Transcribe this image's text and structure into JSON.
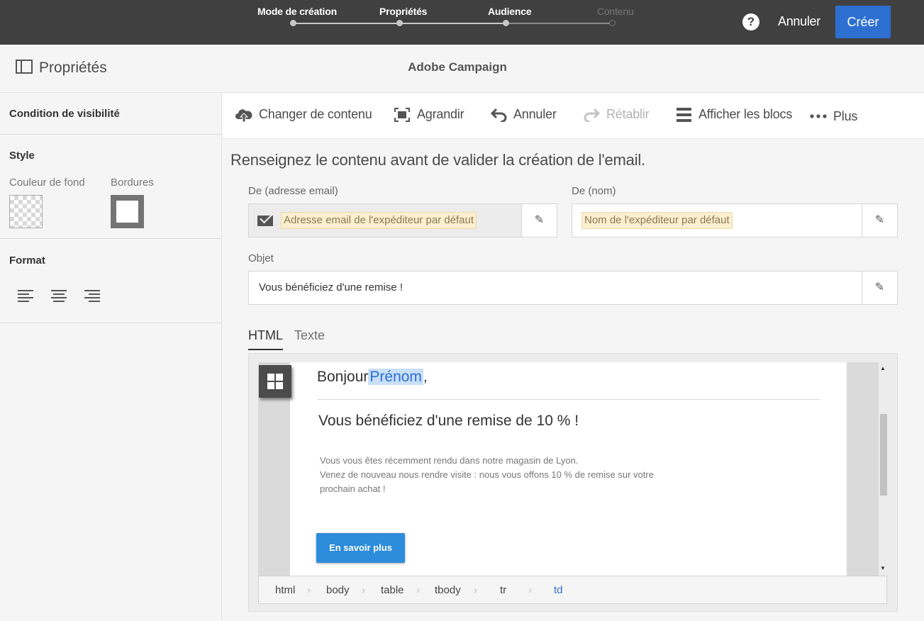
{
  "wizard": {
    "steps": [
      {
        "label": "Mode de création",
        "state": "done"
      },
      {
        "label": "Propriétés",
        "state": "done"
      },
      {
        "label": "Audience",
        "state": "current"
      },
      {
        "label": "Contenu",
        "state": "pending"
      }
    ],
    "help_icon": "?",
    "cancel_label": "Annuler",
    "create_label": "Créer"
  },
  "titlebar": {
    "panel_title": "Propriétés",
    "app_title": "Adobe Campaign"
  },
  "sidebar": {
    "visibility_label": "Condition de visibilité",
    "style_label": "Style",
    "background_color_label": "Couleur de fond",
    "borders_label": "Bordures",
    "format_label": "Format",
    "align_icons": [
      "align-left-icon",
      "align-center-icon",
      "align-right-icon"
    ]
  },
  "toolbar": {
    "change_content": "Changer de contenu",
    "enlarge": "Agrandir",
    "undo": "Annuler",
    "redo": "Rétablir",
    "show_blocks": "Afficher les blocs",
    "more": "Plus"
  },
  "form": {
    "intro": "Renseignez le contenu avant de valider la création de l'email.",
    "from_email_label": "De (adresse email)",
    "from_email_placeholder": "Adresse email de l'expéditeur par défaut",
    "from_name_label": "De (nom)",
    "from_name_placeholder": "Nom de l'expéditeur par défaut",
    "subject_label": "Objet",
    "subject_value": "Vous bénéficiez d'une remise !"
  },
  "tabs": {
    "html": "HTML",
    "text": "Texte"
  },
  "email": {
    "greeting": "Bonjour",
    "firstname_field": "Prénom",
    "greeting_punct": ",",
    "title": "Vous bénéficiez d'une remise de 10 % !",
    "body_line1": "Vous vous êtes récemment rendu dans notre magasin de Lyon.",
    "body_line2": "Venez de nouveau nous rendre visite : nous vous offons 10 % de remise sur votre",
    "body_line3": "prochain achat !",
    "cta": "En savoir  plus"
  },
  "breadcrumb": [
    "html",
    "body",
    "table",
    "tbody",
    "tr",
    "td"
  ],
  "colors": {
    "topbar": "#404040",
    "accent": "#2d6fd1",
    "email_button": "#2d8cdb",
    "placeholder_chip": "#fcefcf"
  }
}
